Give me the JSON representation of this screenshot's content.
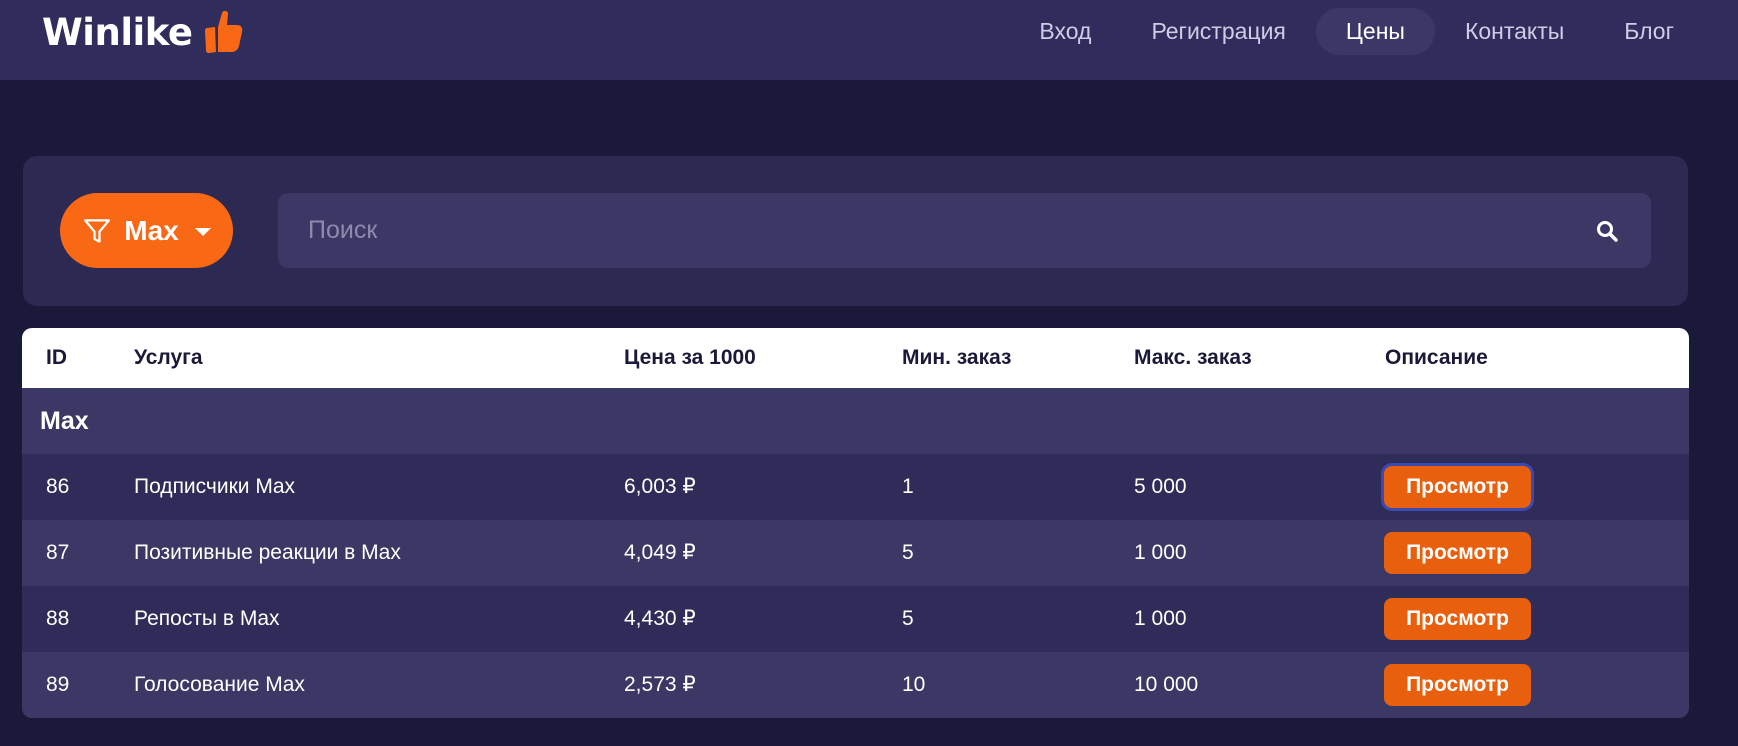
{
  "brand": {
    "name": "Winlike",
    "accent": "#f96815"
  },
  "nav": {
    "items": [
      {
        "label": "Вход",
        "active": false
      },
      {
        "label": "Регистрация",
        "active": false
      },
      {
        "label": "Цены",
        "active": true
      },
      {
        "label": "Контакты",
        "active": false
      },
      {
        "label": "Блог",
        "active": false
      }
    ]
  },
  "filter": {
    "selected": "Max",
    "icon": "funnel-icon"
  },
  "search": {
    "placeholder": "Поиск",
    "value": "",
    "icon": "search-icon"
  },
  "table": {
    "headers": {
      "id": "ID",
      "service": "Услуга",
      "price": "Цена за 1000",
      "min": "Мин. заказ",
      "max": "Макс. заказ",
      "description": "Описание"
    },
    "group": "Max",
    "rows": [
      {
        "id": "86",
        "service": "Подписчики Max",
        "price": "6,003 ₽",
        "min": "1",
        "max": "5 000",
        "action": "Просмотр"
      },
      {
        "id": "87",
        "service": "Позитивные реакции в Max",
        "price": "4,049 ₽",
        "min": "5",
        "max": "1 000",
        "action": "Просмотр"
      },
      {
        "id": "88",
        "service": "Репосты в Max",
        "price": "4,430 ₽",
        "min": "5",
        "max": "1 000",
        "action": "Просмотр"
      },
      {
        "id": "89",
        "service": "Голосование Max",
        "price": "2,573 ₽",
        "min": "10",
        "max": "10 000",
        "action": "Просмотр"
      }
    ]
  }
}
